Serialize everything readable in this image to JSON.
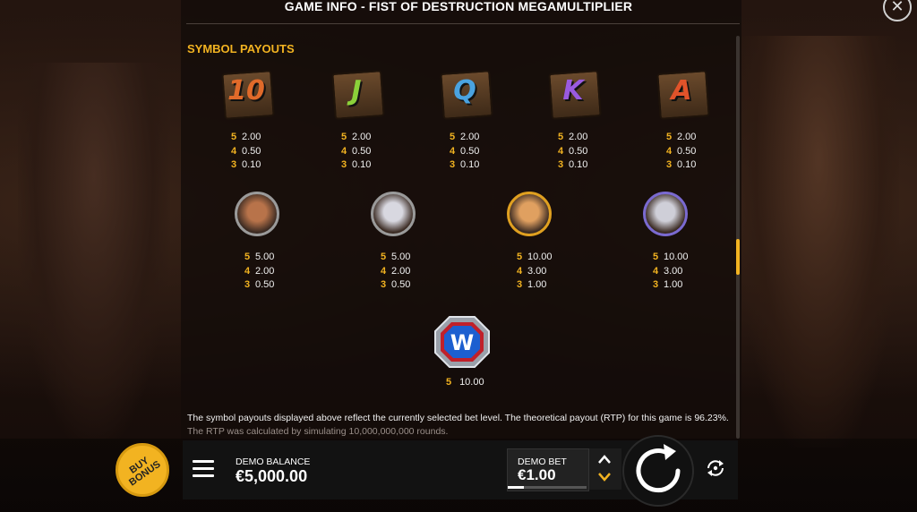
{
  "window": {
    "title": "GAME INFO - FIST OF DESTRUCTION MEGAMULTIPLIER",
    "close_icon": "close-icon"
  },
  "section": {
    "title": "SYMBOL PAYOUTS"
  },
  "symbols_row1": [
    {
      "name": "10",
      "color": "#e06a2a",
      "pays": [
        [
          "5",
          "2.00"
        ],
        [
          "4",
          "0.50"
        ],
        [
          "3",
          "0.10"
        ]
      ]
    },
    {
      "name": "J",
      "color": "#8bd13a",
      "pays": [
        [
          "5",
          "2.00"
        ],
        [
          "4",
          "0.50"
        ],
        [
          "3",
          "0.10"
        ]
      ]
    },
    {
      "name": "Q",
      "color": "#4aa3e0",
      "pays": [
        [
          "5",
          "2.00"
        ],
        [
          "4",
          "0.50"
        ],
        [
          "3",
          "0.10"
        ]
      ]
    },
    {
      "name": "K",
      "color": "#9a5ae0",
      "pays": [
        [
          "5",
          "2.00"
        ],
        [
          "4",
          "0.50"
        ],
        [
          "3",
          "0.10"
        ]
      ]
    },
    {
      "name": "A",
      "color": "#e0532a",
      "pays": [
        [
          "5",
          "2.00"
        ],
        [
          "4",
          "0.50"
        ],
        [
          "3",
          "0.10"
        ]
      ]
    }
  ],
  "symbols_row2": [
    {
      "name": "bearded-fighter",
      "ring": "#9a9a9a",
      "face": "#b8734a",
      "pays": [
        [
          "5",
          "5.00"
        ],
        [
          "4",
          "2.00"
        ],
        [
          "3",
          "0.50"
        ]
      ]
    },
    {
      "name": "white-haired-fighter",
      "ring": "#9a9a9a",
      "face": "#d8d8e0",
      "pays": [
        [
          "5",
          "5.00"
        ],
        [
          "4",
          "2.00"
        ],
        [
          "3",
          "0.50"
        ]
      ]
    },
    {
      "name": "blond-fighter",
      "ring": "#e0a020",
      "face": "#e0a060",
      "pays": [
        [
          "5",
          "10.00"
        ],
        [
          "4",
          "3.00"
        ],
        [
          "3",
          "1.00"
        ]
      ]
    },
    {
      "name": "masked-ninja",
      "ring": "#7a6ad0",
      "face": "#cfcfd8",
      "pays": [
        [
          "5",
          "10.00"
        ],
        [
          "4",
          "3.00"
        ],
        [
          "3",
          "1.00"
        ]
      ]
    }
  ],
  "wild": {
    "letter": "W",
    "pays": [
      [
        "5",
        "10.00"
      ]
    ]
  },
  "description": {
    "line1": "The symbol payouts displayed above reflect the currently selected bet level. The theoretical payout (RTP) for this game is 96.23%.",
    "line2": "The RTP was calculated by simulating 10,000,000,000 rounds."
  },
  "bottom": {
    "buy_bonus": "BUY BONUS",
    "balance_label": "DEMO BALANCE",
    "balance_value": "€5,000.00",
    "bet_label": "DEMO BET",
    "bet_value": "€1.00",
    "bet_level_fraction": 0.2
  },
  "colors": {
    "accent": "#f2b321"
  }
}
